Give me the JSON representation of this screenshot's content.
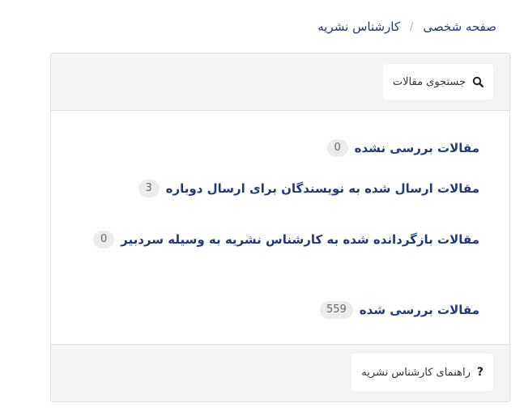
{
  "breadcrumb": {
    "home": "صفحه شخصی",
    "separator": "/",
    "current": "کارشناس نشریه"
  },
  "toolbar": {
    "search_label": "جستجوی مقالات",
    "search_icon": "search-icon"
  },
  "categories": [
    {
      "label": "مقالات بررسی نشده",
      "count": "0"
    },
    {
      "label": "مقالات ارسال شده به نویسندگان برای ارسال دوباره",
      "count": "3"
    },
    {
      "label": "مقالات بازگردانده شده به کارشناس نشریه به وسیله سردبیر",
      "count": "0"
    },
    {
      "label": "مقالات بررسی شده",
      "count": "559"
    }
  ],
  "footer": {
    "help_label": "راهنمای کارشناس نشریه",
    "help_icon": "question-icon"
  },
  "colors": {
    "link": "#1f3a7a",
    "panel_bg": "#f4f4f5",
    "badge_bg": "#ececee",
    "border": "#dcdfe4"
  }
}
